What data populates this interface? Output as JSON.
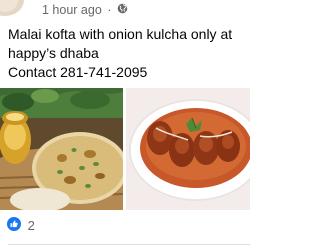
{
  "post": {
    "timestamp": "1 hour ago",
    "separator": "·",
    "privacy_icon": "globe-icon",
    "text_lines": [
      "Malai kofta with onion kulcha only at",
      "happy’s dhaba",
      "Contact 281-741-2095"
    ],
    "images": [
      {
        "icon": "kulcha-photo",
        "description_icon": "naan-bread-image"
      },
      {
        "icon": "kofta-photo",
        "description_icon": "kofta-curry-image"
      }
    ],
    "reactions": {
      "icon": "like-icon",
      "count": "2"
    }
  },
  "colors": {
    "meta_gray": "#65676b",
    "text_dark": "#050505",
    "like_blue": "#1877f2"
  }
}
